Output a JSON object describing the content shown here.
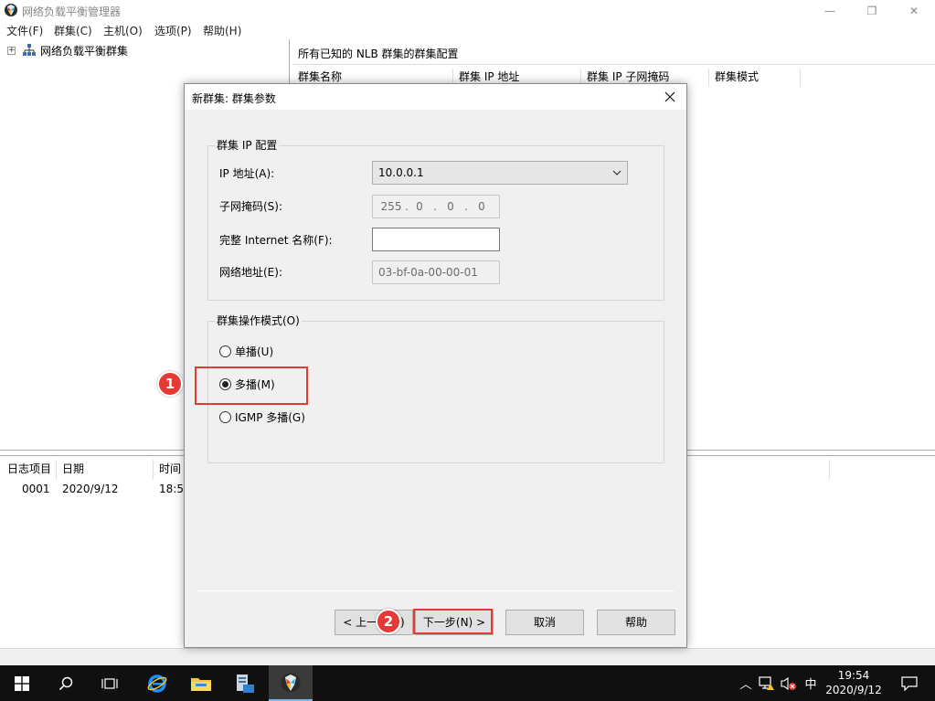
{
  "window": {
    "title": "网络负载平衡管理器",
    "minimize": "—",
    "restore": "❐",
    "close": "✕"
  },
  "menu": [
    "文件(F)",
    "群集(C)",
    "主机(O)",
    "选项(P)",
    "帮助(H)"
  ],
  "tree": {
    "expander": "+",
    "root": "网络负载平衡群集"
  },
  "cluster_pane": {
    "caption": "所有已知的 NLB 群集的群集配置",
    "columns": [
      "群集名称",
      "群集 IP 地址",
      "群集 IP 子网掩码",
      "群集模式"
    ]
  },
  "log_pane": {
    "columns": [
      "日志项目",
      "日期",
      "时间"
    ],
    "rows": [
      {
        "item": "0001",
        "date": "2020/9/12",
        "time": "18:51"
      }
    ]
  },
  "dialog": {
    "title": "新群集: 群集参数",
    "ip_group": {
      "title": "群集 IP 配置",
      "ip_label": "IP 地址(A):",
      "ip_value": "10.0.0.1",
      "subnet_label": "子网掩码(S):",
      "subnet_octets": [
        "255",
        "0",
        "0",
        "0"
      ],
      "fqdn_label": "完整 Internet 名称(F):",
      "fqdn_value": "",
      "netaddr_label": "网络地址(E):",
      "netaddr_value": "03-bf-0a-00-00-01"
    },
    "mode_group": {
      "title": "群集操作模式(O)",
      "options": [
        "单播(U)",
        "多播(M)",
        "IGMP 多播(G)"
      ],
      "selected": "多播(M)"
    },
    "buttons": {
      "back": "< 上一步(B)",
      "next": "下一步(N) >",
      "cancel": "取消",
      "help": "帮助"
    }
  },
  "annotations": {
    "marker1": "1",
    "marker2": "2",
    "color": "#e53935"
  },
  "taskbar": {
    "tray_chevron": "︿",
    "ime": "中",
    "time": "19:54",
    "date": "2020/9/12"
  }
}
